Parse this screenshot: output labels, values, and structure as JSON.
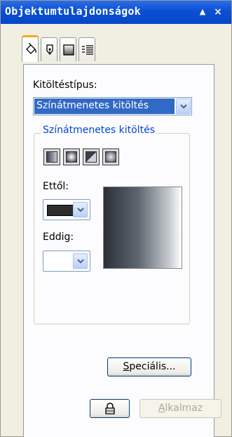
{
  "window": {
    "title": "Objektumtulajdonságok",
    "pin_glyph": "▲",
    "close_glyph": "×"
  },
  "tabs": [
    {
      "name": "fill-tab",
      "icon": "paint-bucket-icon",
      "active": true
    },
    {
      "name": "outline-tab",
      "icon": "pen-nib-icon",
      "active": false
    },
    {
      "name": "transparency-tab",
      "icon": "square-gradient-icon",
      "active": false
    },
    {
      "name": "general-tab",
      "icon": "list-icon",
      "active": false
    }
  ],
  "fill": {
    "type_label": "Kitöltéstípus:",
    "type_value": "Színátmenetes kitöltés",
    "group_title": "Színátmenetes kitöltés",
    "gradient_types": [
      "linear",
      "radial",
      "conical",
      "square"
    ],
    "from_label": "Ettől:",
    "from_color": "#2d2d2d",
    "to_label": "Eddig:",
    "to_color": "#ffffff"
  },
  "buttons": {
    "special_pre": "",
    "special_u": "S",
    "special_post": "peciális...",
    "lock_icon": "lock-icon",
    "apply_u": "A",
    "apply_post": "lkalmaz"
  }
}
